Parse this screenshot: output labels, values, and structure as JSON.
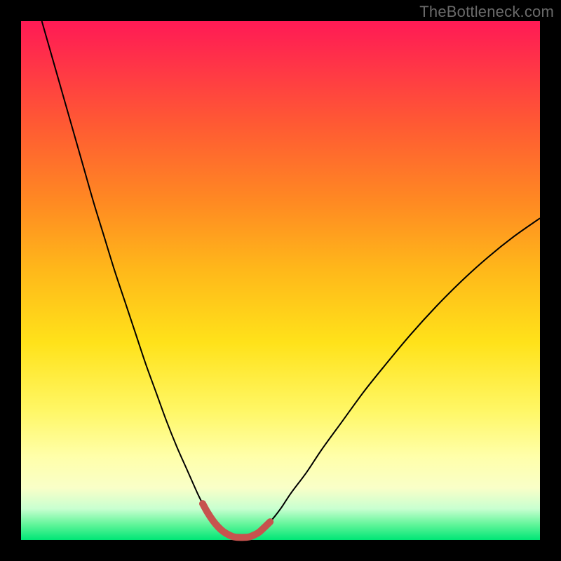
{
  "watermark": "TheBottleneck.com",
  "colors": {
    "background": "#000000",
    "curve_stroke": "#000000",
    "highlight_stroke": "#c7534e",
    "gradient_top": "#ff1a55",
    "gradient_bottom": "#00e676"
  },
  "chart_data": {
    "type": "line",
    "title": "",
    "xlabel": "",
    "ylabel": "",
    "xlim": [
      0,
      100
    ],
    "ylim": [
      0,
      100
    ],
    "watermark": "TheBottleneck.com",
    "series": [
      {
        "name": "bottleneck_pct",
        "x": [
          4,
          6,
          8,
          10,
          12,
          14,
          16,
          18,
          20,
          22,
          24,
          26,
          28,
          30,
          32,
          34,
          35,
          36,
          37,
          38,
          39,
          40,
          41,
          42,
          43,
          44,
          45,
          46,
          48,
          50,
          52,
          55,
          58,
          62,
          66,
          70,
          75,
          80,
          85,
          90,
          95,
          100
        ],
        "y": [
          100,
          93,
          86,
          79,
          72,
          65,
          58.5,
          52,
          46,
          40,
          34,
          28.5,
          23,
          18,
          13.5,
          9,
          7,
          5.2,
          3.7,
          2.5,
          1.6,
          1.0,
          0.6,
          0.5,
          0.5,
          0.6,
          1.0,
          1.6,
          3.5,
          6,
          9,
          13,
          17.5,
          23,
          28.5,
          33.5,
          39.5,
          45,
          50,
          54.5,
          58.5,
          62
        ]
      }
    ],
    "highlight": {
      "name": "optimal_range",
      "x_start": 35,
      "x_end": 49,
      "threshold_y": 10,
      "stroke_width_px": 10,
      "stroke_color": "#c7534e"
    },
    "notes": "V-shaped bottleneck curve over a vertical rainbow gradient (red at high bottleneck, green at zero). No visible axes, ticks, or labels. Values estimated from pixel positions; x is an arbitrary 0-100 parameter axis, y is bottleneck percentage 0-100."
  }
}
